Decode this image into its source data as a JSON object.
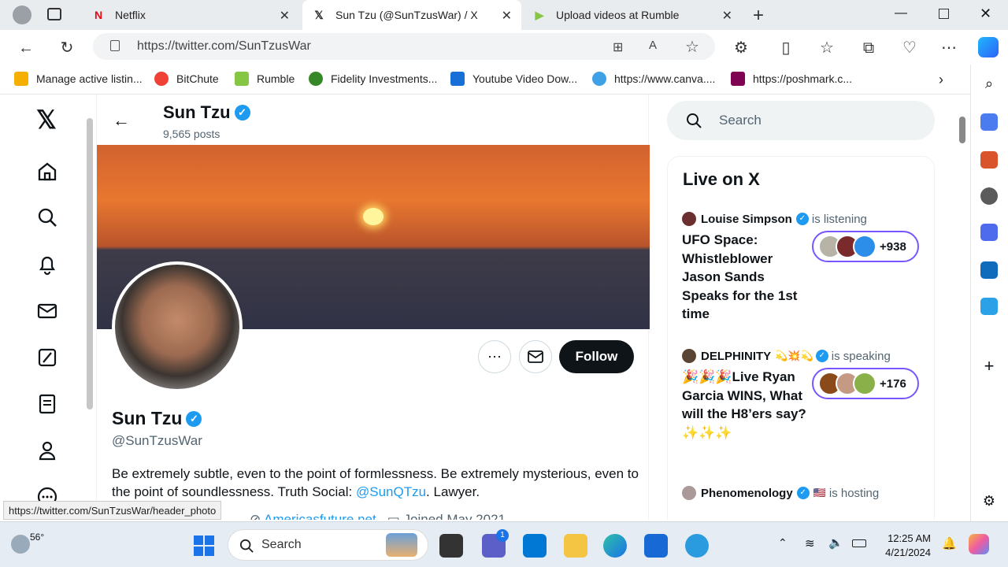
{
  "browser": {
    "tabs": [
      {
        "label": "Netflix",
        "icon": "netflix-icon"
      },
      {
        "label": "Sun Tzu (@SunTzusWar) / X",
        "icon": "x-logo-icon"
      },
      {
        "label": "Upload videos at Rumble",
        "icon": "rumble-icon"
      }
    ],
    "url": "https://twitter.com/SunTzusWar",
    "bookmarks": [
      "Manage active listin...",
      "BitChute",
      "Rumble",
      "Fidelity Investments...",
      "Youtube Video Dow...",
      "https://www.canva....",
      "https://poshmark.c..."
    ],
    "status_url": "https://twitter.com/SunTzusWar/header_photo"
  },
  "profile": {
    "header_name": "Sun Tzu",
    "posts": "9,565 posts",
    "name": "Sun Tzu",
    "handle": "@SunTzusWar",
    "follow": "Follow",
    "bio_text": "Be extremely subtle, even to the point of formlessness. Be extremely mysterious, even to the point of soundlessness. Truth Social: ",
    "bio_link": "@SunQTzu",
    "bio_end": ". Lawyer.",
    "website": "Americasfuture.net",
    "joined": "Joined May 2021"
  },
  "sidebar": {
    "search_placeholder": "Search",
    "live_title": "Live on X",
    "spaces": [
      {
        "host": "Louise Simpson",
        "status": "is listening",
        "title": "UFO Space: Whistleblower Jason Sands Speaks for the 1st time",
        "count": "+938"
      },
      {
        "host": "DELPHINITY",
        "host_emoji": "💫💥💫",
        "status": "is speaking",
        "title": "🎉🎉🎉Live Ryan Garcia WINS, What will the H8’ers say? ✨✨✨",
        "count": "+176"
      },
      {
        "host": "Phenomenology",
        "host_emoji": "🇺🇸",
        "status": "is hosting"
      }
    ]
  },
  "taskbar": {
    "weather": "56°",
    "search": "Search",
    "teams_badge": "1",
    "time": "12:25 AM",
    "date": "4/21/2024"
  },
  "colors": {
    "accent": "#1d9bf0",
    "space_border": "#7856ff",
    "follow_bg": "#0f1419"
  }
}
